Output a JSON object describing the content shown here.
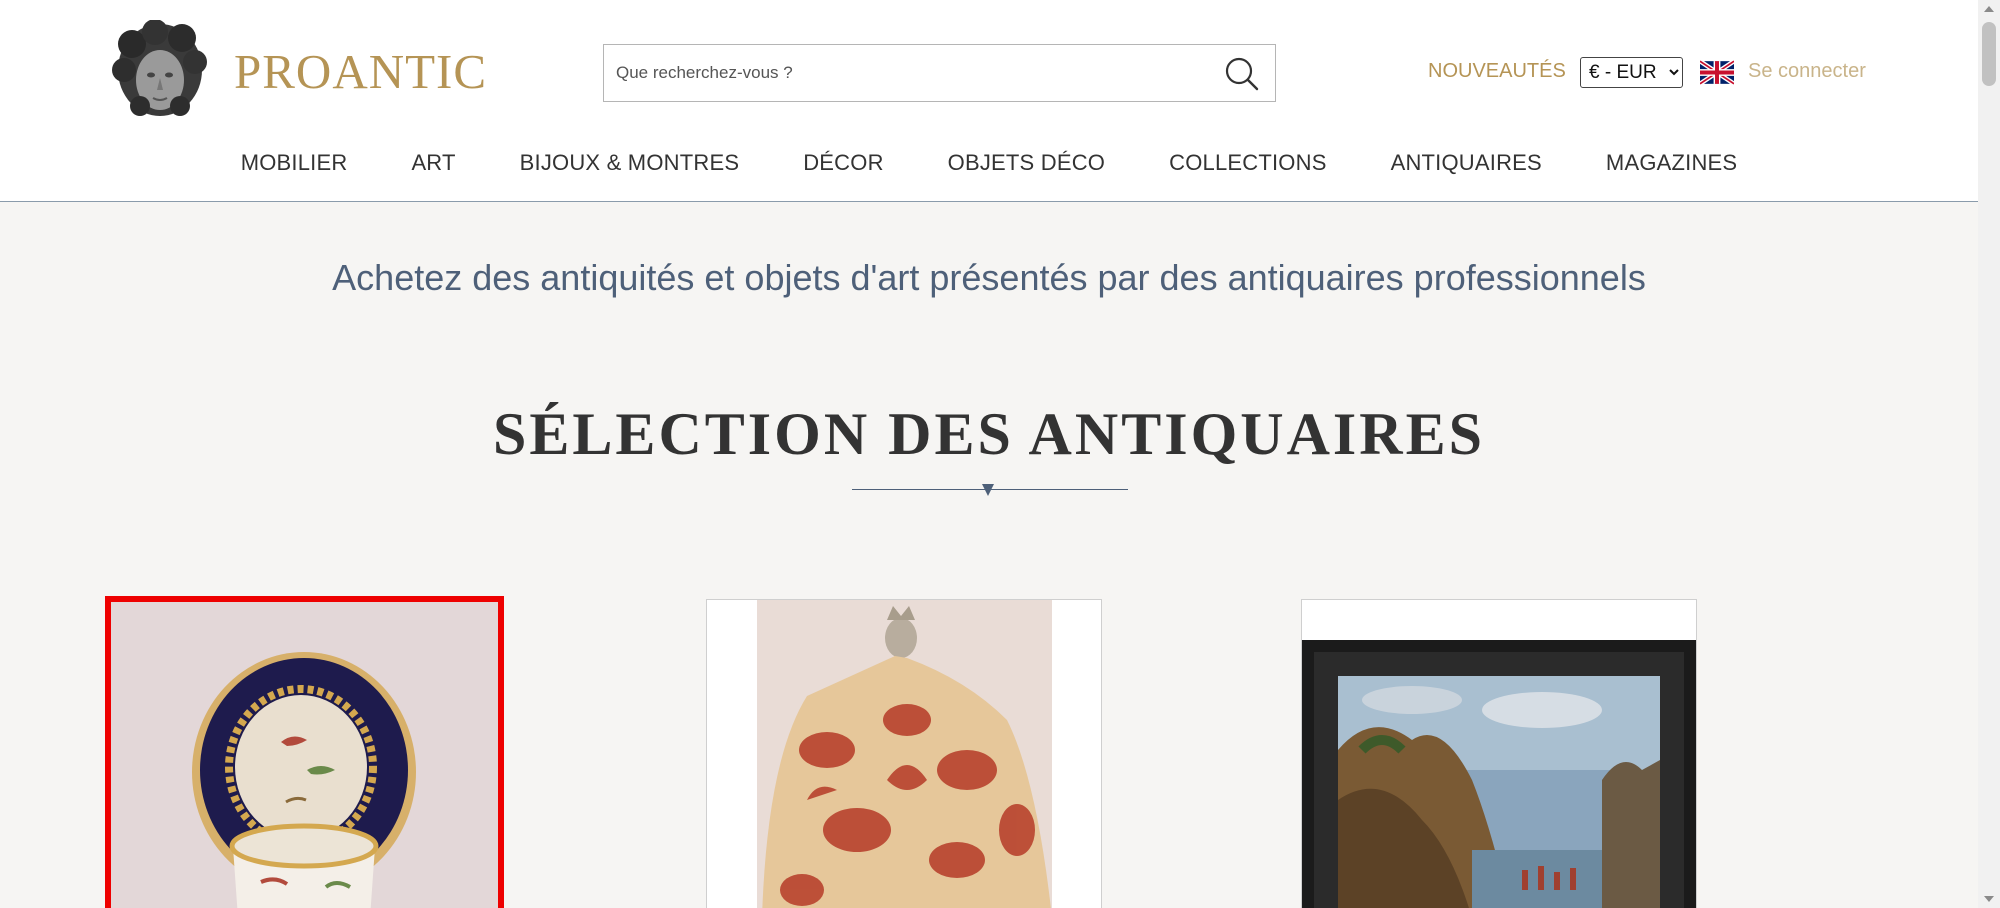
{
  "header": {
    "logo_text": "PROANTIC",
    "search_placeholder": "Que recherchez-vous ?",
    "nouveautes": "NOUVEAUTÉS",
    "currency": {
      "selected": "€ - EUR",
      "options": [
        "€ - EUR"
      ]
    },
    "login": "Se connecter",
    "icons": [
      "search-icon",
      "uk-flag-icon",
      "logo-head-icon"
    ]
  },
  "nav": {
    "items": [
      "MOBILIER",
      "ART",
      "BIJOUX & MONTRES",
      "DÉCOR",
      "OBJETS DÉCO",
      "COLLECTIONS",
      "ANTIQUAIRES",
      "MAGAZINES"
    ]
  },
  "main": {
    "tagline": "Achetez des antiquités et objets d'art présentés par des antiquaires professionnels",
    "section_title": "SÉLECTION DES ANTIQUAIRES"
  },
  "colors": {
    "brand_gold": "#b59455",
    "slate_blue": "#4e6079",
    "highlight_red": "#ee0000",
    "page_bg": "#f6f5f3"
  }
}
